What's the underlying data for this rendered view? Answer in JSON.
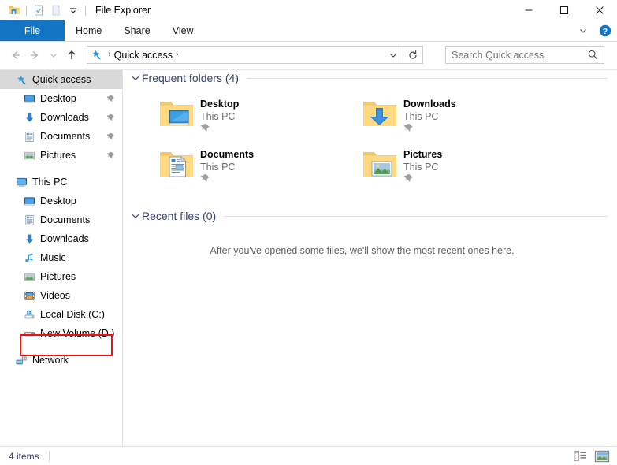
{
  "window": {
    "title": "File Explorer",
    "quick_access_toolbar": [
      {
        "name": "explorer-icon",
        "label": "File Explorer"
      },
      {
        "name": "properties-icon",
        "label": "Properties"
      },
      {
        "name": "new-folder-icon",
        "label": "New folder"
      },
      {
        "name": "customize-chevron-icon",
        "label": "Customize Quick Access Toolbar"
      }
    ],
    "controls": {
      "minimize": "Minimize",
      "maximize": "Maximize",
      "close": "Close"
    }
  },
  "ribbon": {
    "tabs": [
      {
        "label": "File",
        "active": true
      },
      {
        "label": "Home",
        "active": false
      },
      {
        "label": "Share",
        "active": false
      },
      {
        "label": "View",
        "active": false
      }
    ],
    "collapse_label": "Minimize the Ribbon",
    "help_label": "Help"
  },
  "addressbar": {
    "back_label": "Back",
    "forward_label": "Forward",
    "recent_label": "Recent locations",
    "up_label": "Up",
    "breadcrumb": [
      {
        "icon": "quick-access-star-icon",
        "label": ""
      },
      {
        "label": "Quick access"
      }
    ],
    "dropdown_label": "Previous locations",
    "refresh_label": "Refresh",
    "search": {
      "placeholder": "Search Quick access",
      "value": ""
    }
  },
  "sidebar": {
    "groups": [
      {
        "header": {
          "label": "Quick access",
          "icon": "quick-access-star-icon",
          "selected": true
        },
        "items": [
          {
            "label": "Desktop",
            "icon": "desktop-icon",
            "pinned": true
          },
          {
            "label": "Downloads",
            "icon": "downloads-icon",
            "pinned": true
          },
          {
            "label": "Documents",
            "icon": "documents-icon",
            "pinned": true
          },
          {
            "label": "Pictures",
            "icon": "pictures-icon",
            "pinned": true
          }
        ]
      },
      {
        "header": {
          "label": "This PC",
          "icon": "this-pc-icon",
          "selected": false
        },
        "items": [
          {
            "label": "Desktop",
            "icon": "desktop-icon",
            "pinned": false
          },
          {
            "label": "Documents",
            "icon": "documents-icon",
            "pinned": false
          },
          {
            "label": "Downloads",
            "icon": "downloads-icon",
            "pinned": false
          },
          {
            "label": "Music",
            "icon": "music-icon",
            "pinned": false
          },
          {
            "label": "Pictures",
            "icon": "pictures-icon",
            "pinned": false
          },
          {
            "label": "Videos",
            "icon": "videos-icon",
            "pinned": false
          },
          {
            "label": "Local Disk (C:)",
            "icon": "local-disk-icon",
            "pinned": false
          },
          {
            "label": "New Volume (D:)",
            "icon": "drive-icon",
            "pinned": false,
            "highlighted": true
          }
        ]
      },
      {
        "header": {
          "label": "Network",
          "icon": "network-icon",
          "selected": false
        },
        "items": []
      }
    ],
    "highlight_color": "#ee1111"
  },
  "main": {
    "frequent_folders": {
      "title": "Frequent folders (4)",
      "expanded": true,
      "items": [
        {
          "name": "Desktop",
          "location": "This PC",
          "icon": "folder-desktop-icon",
          "pinned": true
        },
        {
          "name": "Downloads",
          "location": "This PC",
          "icon": "folder-downloads-icon",
          "pinned": true
        },
        {
          "name": "Documents",
          "location": "This PC",
          "icon": "folder-documents-icon",
          "pinned": true
        },
        {
          "name": "Pictures",
          "location": "This PC",
          "icon": "folder-pictures-icon",
          "pinned": true
        }
      ]
    },
    "recent_files": {
      "title": "Recent files (0)",
      "expanded": true,
      "empty_message": "After you've opened some files, we'll show the most recent ones here."
    }
  },
  "statusbar": {
    "item_count": "4 items",
    "views": [
      {
        "name": "details-view-button",
        "label": "Details view",
        "active": false
      },
      {
        "name": "large-icons-view-button",
        "label": "Large icons view",
        "active": true
      }
    ]
  },
  "colors": {
    "accent": "#1175c4",
    "group_header": "#34436e",
    "highlight": "#ee1111",
    "selected_row": "#d9d9d9"
  }
}
